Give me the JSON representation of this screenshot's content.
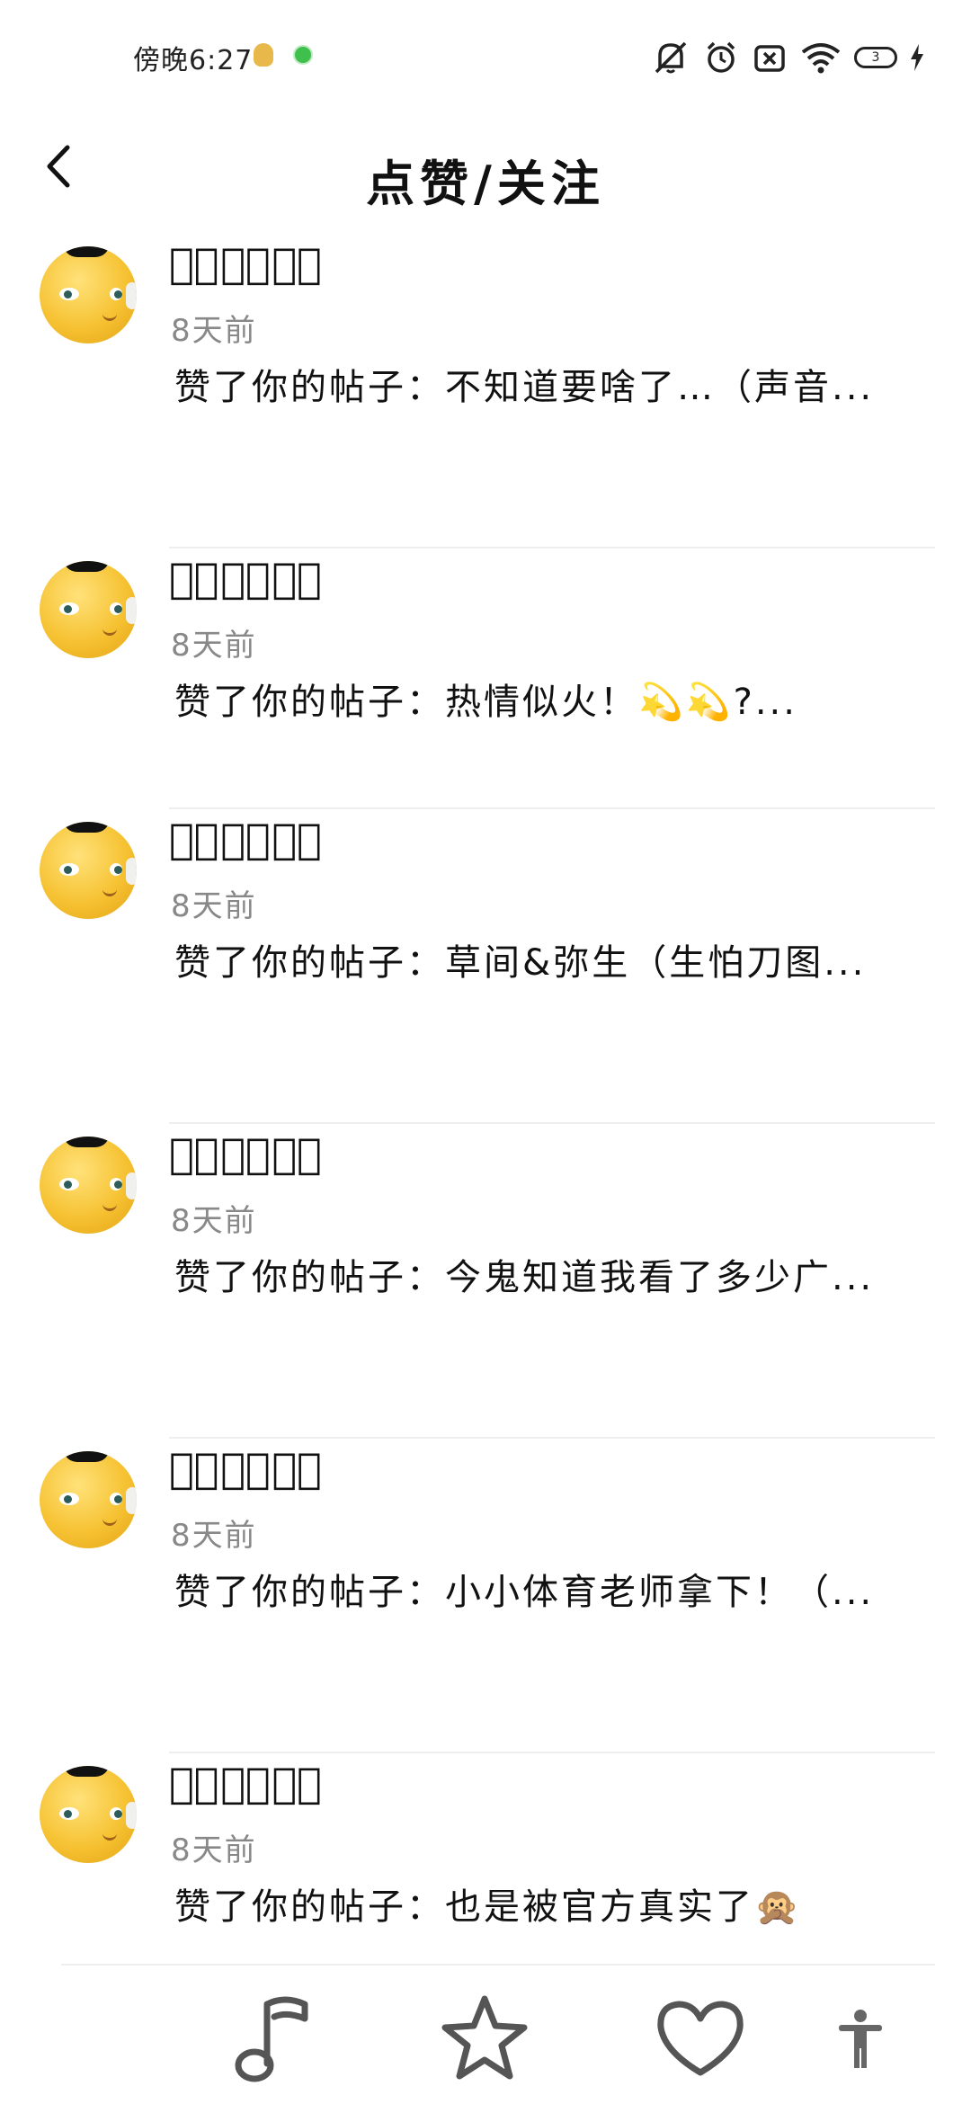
{
  "status_bar": {
    "time": "傍晚6:27",
    "battery_level": "3",
    "icons": [
      "notification-icon",
      "app-dot-icon",
      "mute-icon",
      "alarm-icon",
      "sim-off-icon",
      "wifi-icon",
      "battery-icon",
      "charging-icon"
    ]
  },
  "header": {
    "back_icon": "chevron-left-icon",
    "title": "点赞/关注"
  },
  "notifications": [
    {
      "user": "侏ᷝ孑ᷝ酱ᷝ",
      "time": "8天前",
      "message": "赞了你的帖子：不知道要啥了…（声音..."
    },
    {
      "user": "侏ᷝ孑ᷝ酱ᷝ",
      "time": "8天前",
      "message": "赞了你的帖子：热情似火！💫💫?..."
    },
    {
      "user": "侏ᷝ孑ᷝ酱ᷝ",
      "time": "8天前",
      "message": "赞了你的帖子：草间&弥生（生怕刀图..."
    },
    {
      "user": "侏ᷝ孑ᷝ酱ᷝ",
      "time": "8天前",
      "message": "赞了你的帖子：今鬼知道我看了多少广..."
    },
    {
      "user": "侏ᷝ孑ᷝ酱ᷝ",
      "time": "8天前",
      "message": "赞了你的帖子：小小体育老师拿下！（..."
    },
    {
      "user": "侏ᷝ孑ᷝ酱ᷝ",
      "time": "8天前",
      "message": "赞了你的帖子：也是被官方真实了🙊"
    }
  ],
  "bottom_nav": {
    "items": [
      "music-note-icon",
      "star-icon",
      "heart-icon",
      "accessibility-icon"
    ]
  },
  "colors": {
    "text_primary": "#111111",
    "text_secondary": "#888888",
    "divider": "#eeeeee",
    "avatar_yellow": "#f6c233"
  }
}
